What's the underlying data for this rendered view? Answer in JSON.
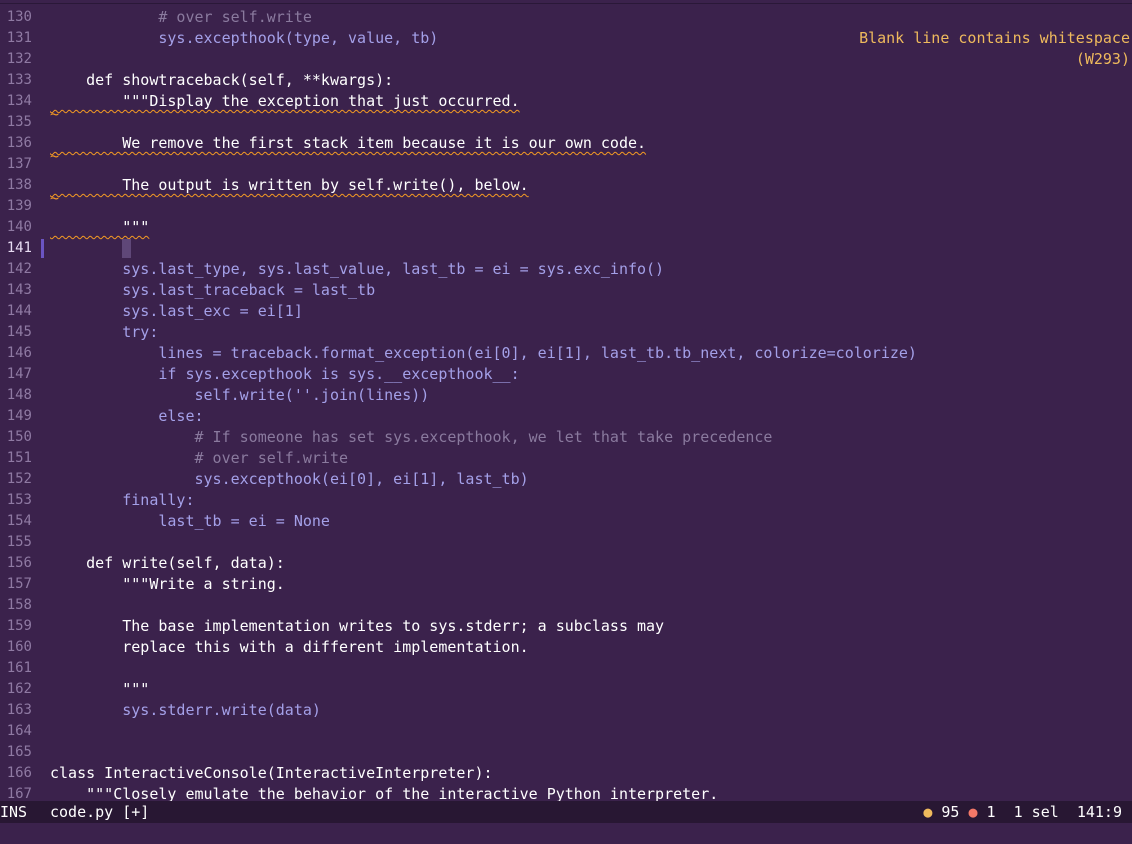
{
  "lines": [
    {
      "n": "130",
      "text": "            # over self.write"
    },
    {
      "n": "131",
      "text": "            sys.excepthook(type, value, tb)"
    },
    {
      "n": "132",
      "text": ""
    },
    {
      "n": "133",
      "text": "    def showtraceback(self, **kwargs):"
    },
    {
      "n": "134",
      "text": "        \"\"\"Display the exception that just occurred."
    },
    {
      "n": "135",
      "text": ""
    },
    {
      "n": "136",
      "text": "        We remove the first stack item because it is our own code."
    },
    {
      "n": "137",
      "text": ""
    },
    {
      "n": "138",
      "text": "        The output is written by self.write(), below."
    },
    {
      "n": "139",
      "text": ""
    },
    {
      "n": "140",
      "text": "        \"\"\""
    },
    {
      "n": "141",
      "text": ""
    },
    {
      "n": "142",
      "text": "        sys.last_type, sys.last_value, last_tb = ei = sys.exc_info()"
    },
    {
      "n": "143",
      "text": "        sys.last_traceback = last_tb"
    },
    {
      "n": "144",
      "text": "        sys.last_exc = ei[1]"
    },
    {
      "n": "145",
      "text": "        try:"
    },
    {
      "n": "146",
      "text": "            lines = traceback.format_exception(ei[0], ei[1], last_tb.tb_next, colorize=colorize)"
    },
    {
      "n": "147",
      "text": "            if sys.excepthook is sys.__excepthook__:"
    },
    {
      "n": "148",
      "text": "                self.write(''.join(lines))"
    },
    {
      "n": "149",
      "text": "            else:"
    },
    {
      "n": "150",
      "text": "                # If someone has set sys.excepthook, we let that take precedence"
    },
    {
      "n": "151",
      "text": "                # over self.write"
    },
    {
      "n": "152",
      "text": "                sys.excepthook(ei[0], ei[1], last_tb)"
    },
    {
      "n": "153",
      "text": "        finally:"
    },
    {
      "n": "154",
      "text": "            last_tb = ei = None"
    },
    {
      "n": "155",
      "text": ""
    },
    {
      "n": "156",
      "text": "    def write(self, data):"
    },
    {
      "n": "157",
      "text": "        \"\"\"Write a string."
    },
    {
      "n": "158",
      "text": ""
    },
    {
      "n": "159",
      "text": "        The base implementation writes to sys.stderr; a subclass may"
    },
    {
      "n": "160",
      "text": "        replace this with a different implementation."
    },
    {
      "n": "161",
      "text": ""
    },
    {
      "n": "162",
      "text": "        \"\"\""
    },
    {
      "n": "163",
      "text": "        sys.stderr.write(data)"
    },
    {
      "n": "164",
      "text": ""
    },
    {
      "n": "165",
      "text": ""
    },
    {
      "n": "166",
      "text": "class InteractiveConsole(InteractiveInterpreter):"
    },
    {
      "n": "167",
      "text": "    \"\"\"Closely emulate the behavior of the interactive Python interpreter."
    }
  ],
  "diagnostic": {
    "message": "Blank line contains whitespace",
    "code": "(W293)"
  },
  "tilde_char": "~",
  "status": {
    "mode": "INS",
    "file": "code.py [+]",
    "warn_dot": "●",
    "warn_count": "95",
    "err_dot": "●",
    "err_count": "1",
    "selection": "1 sel",
    "position": "141:9"
  },
  "colors": {
    "background": "#3b224c",
    "statusbar": "#281733",
    "warning": "#efba5d",
    "error": "#f47868",
    "self": "#9ff28f",
    "punctuation": "#a4a0e8"
  }
}
